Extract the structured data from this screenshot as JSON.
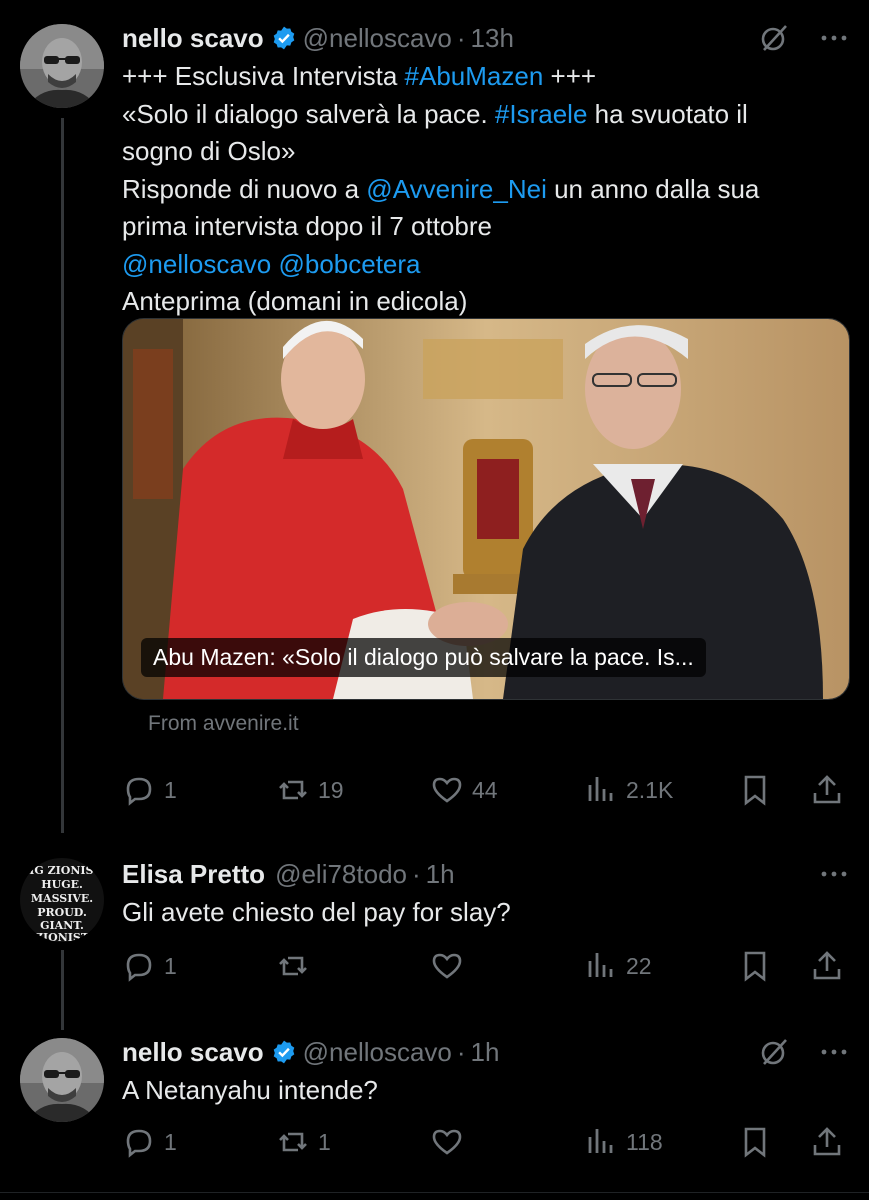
{
  "main_tweet": {
    "name": "nello scavo",
    "handle": "@nelloscavo",
    "time": "13h",
    "lines": [
      [
        {
          "t": "+++ Esclusiva Intervista "
        },
        {
          "t": "#AbuMazen",
          "link": true
        },
        {
          "t": " +++"
        }
      ],
      [
        {
          "t": "«Solo il dialogo salverà la pace. "
        },
        {
          "t": "#Israele",
          "link": true
        },
        {
          "t": " ha svuotato il"
        }
      ],
      [
        {
          "t": "sogno di Oslo»"
        }
      ],
      [
        {
          "t": "Risponde di nuovo a "
        },
        {
          "t": "@Avvenire_Nei",
          "link": true
        },
        {
          "t": " un anno dalla sua"
        }
      ],
      [
        {
          "t": "prima intervista dopo il 7 ottobre"
        }
      ],
      [
        {
          "t": "@nelloscavo @bobcetera",
          "link": true
        }
      ],
      [
        {
          "t": "Anteprima (domani in edicola)"
        }
      ]
    ],
    "media_caption": "Abu Mazen: «Solo il dialogo può salvare la pace. Is...",
    "source": "From avvenire.it",
    "stats": {
      "replies": "1",
      "reposts": "19",
      "likes": "44",
      "views": "2.1K"
    }
  },
  "reply_1": {
    "name": "Elisa Pretto",
    "handle": "@eli78todo",
    "time": "1h",
    "text": "Gli avete chiesto del pay for slay?",
    "avatar_text": [
      "BIG ZIONIST.",
      "HUGE.",
      "MASSIVE.",
      "PROUD.",
      "GIANT.",
      "ZIONIST"
    ],
    "stats": {
      "replies": "1",
      "reposts": "",
      "likes": "",
      "views": "22"
    }
  },
  "reply_2": {
    "name": "nello scavo",
    "handle": "@nelloscavo",
    "time": "1h",
    "text": "A Netanyahu intende?",
    "stats": {
      "replies": "1",
      "reposts": "1",
      "likes": "",
      "views": "118"
    }
  },
  "dot": "·",
  "colors": {
    "link": "#1d9bf0",
    "muted": "#71767b",
    "text": "#e7e9ea",
    "background": "#000000"
  }
}
